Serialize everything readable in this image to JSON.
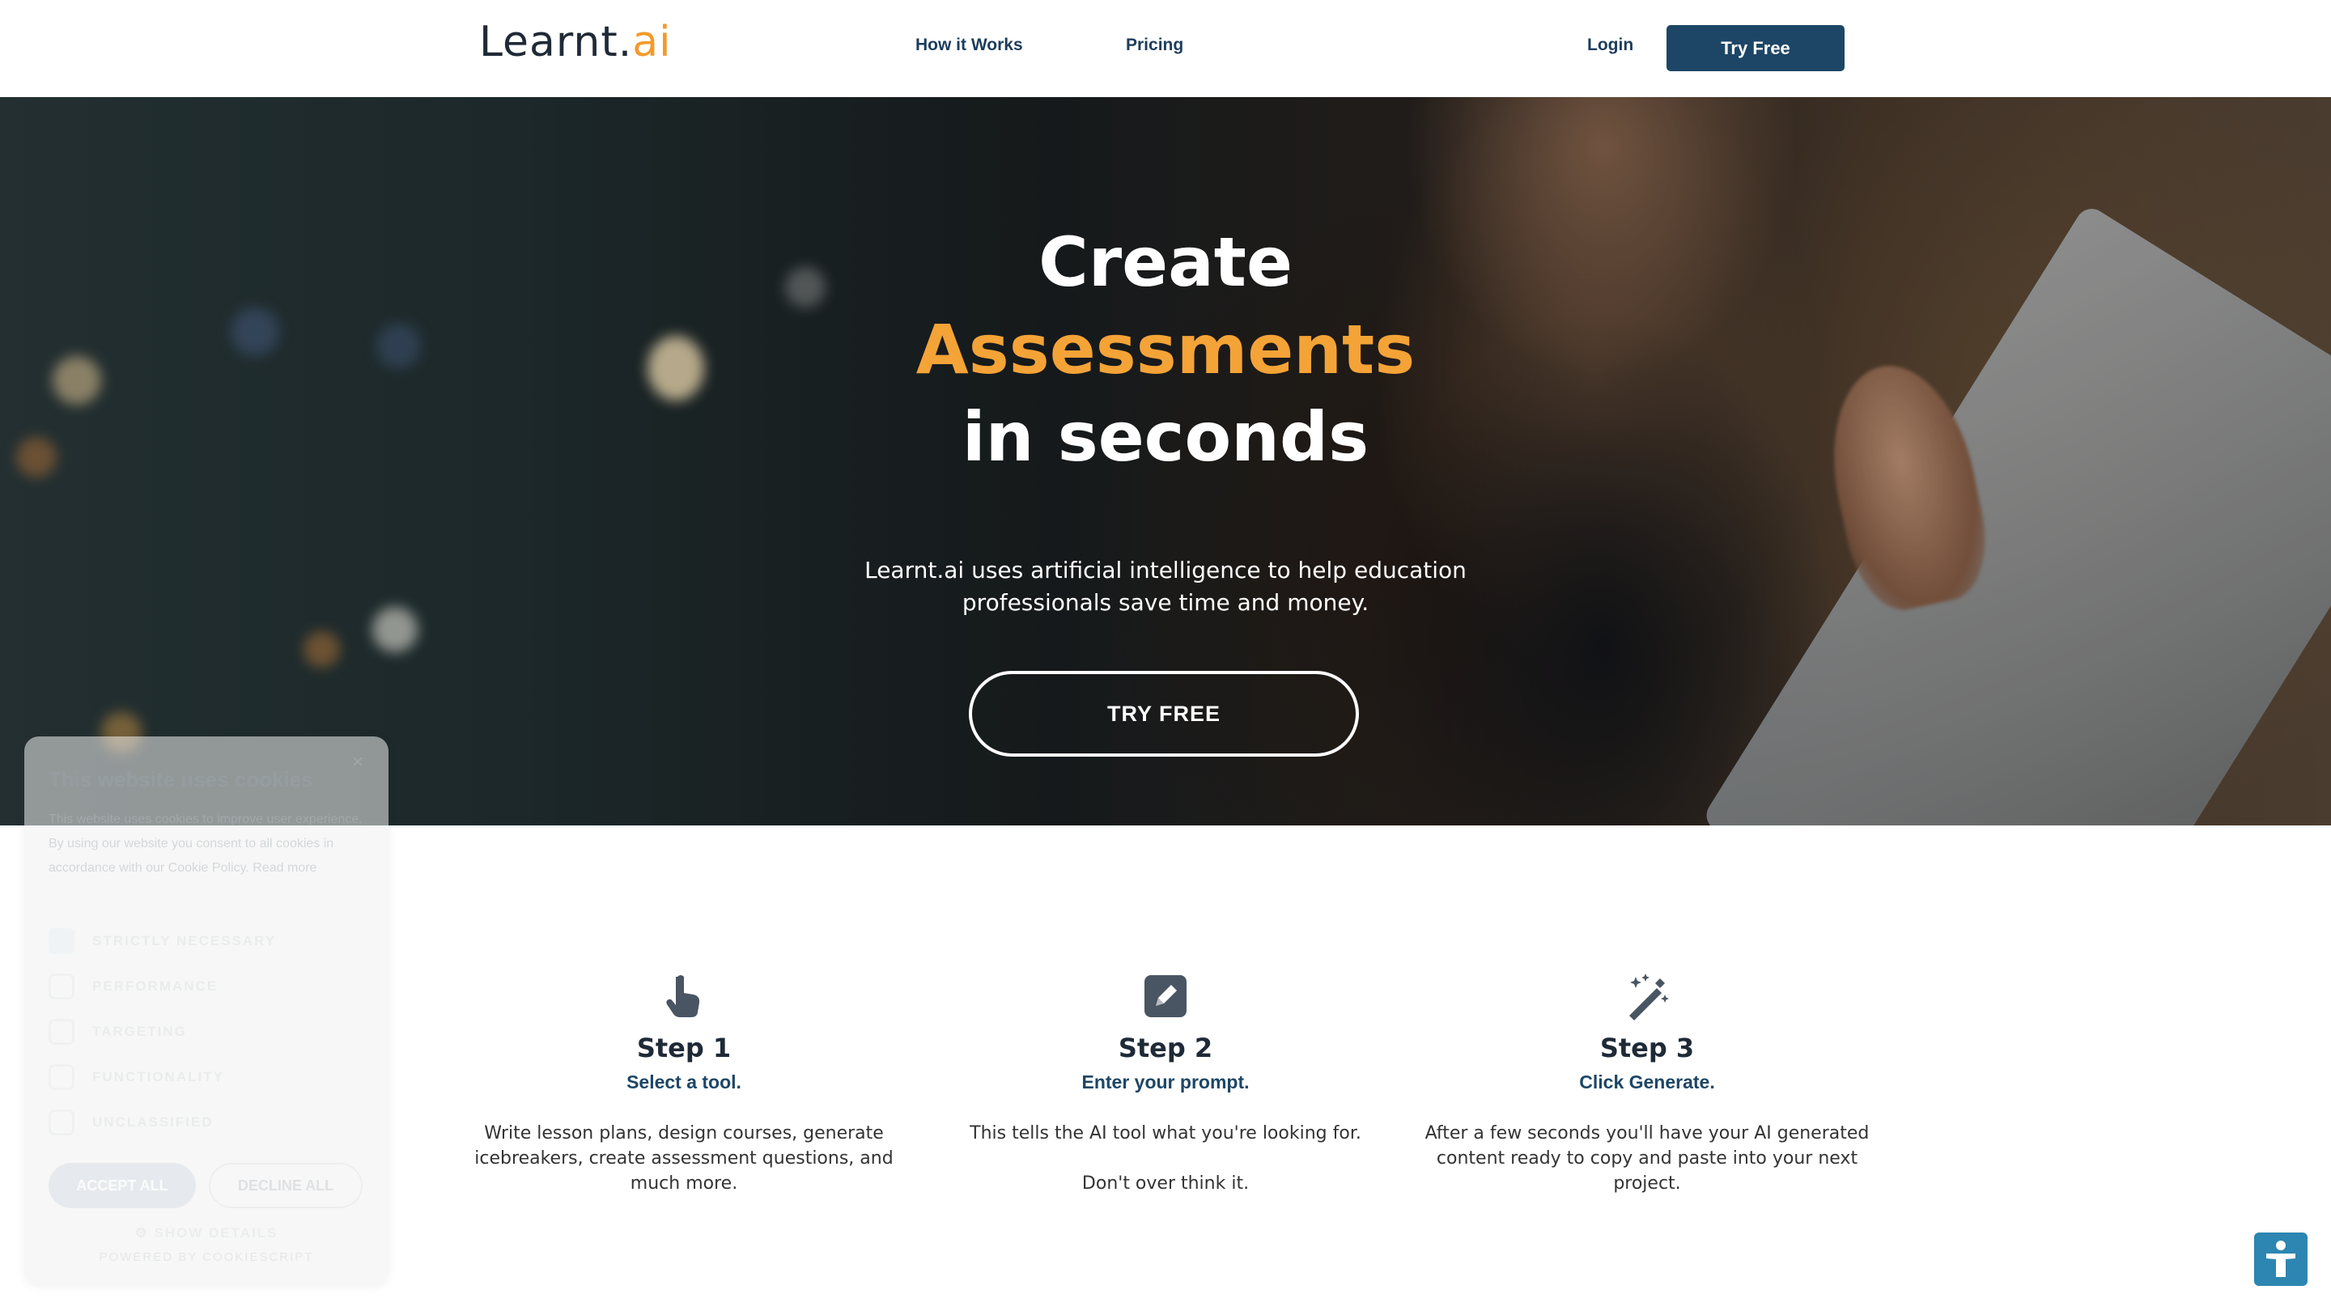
{
  "nav": {
    "logo_main": "Learnt.",
    "logo_accent": "ai",
    "links": [
      "How it Works",
      "Pricing"
    ],
    "login": "Login",
    "cta": "Try Free"
  },
  "hero": {
    "title_line1": "Create",
    "title_accent": "Assessments",
    "title_line3": "in seconds",
    "subtitle": "Learnt.ai uses artificial intelligence to help education professionals save time and money.",
    "cta": "TRY FREE",
    "accent_color": "#f4a337"
  },
  "steps": [
    {
      "icon": "pointer-hand-icon",
      "title": "Step 1",
      "subtitle": "Select a tool.",
      "description": "Write lesson plans, design courses, generate icebreakers, create assessment questions, and much more."
    },
    {
      "icon": "pencil-square-icon",
      "title": "Step 2",
      "subtitle": "Enter your prompt.",
      "description": "This tells the AI tool what you're looking for.\n\nDon't over think it."
    },
    {
      "icon": "magic-wand-icon",
      "title": "Step 3",
      "subtitle": "Click Generate.",
      "description": "After a few seconds you'll have your AI generated content ready to copy and paste into your next project."
    }
  ],
  "cookie": {
    "title": "This website uses cookies",
    "text": "This website uses cookies to improve user experience. By using our website you consent to all cookies in accordance with our Cookie Policy. Read more",
    "options": [
      "STRICTLY NECESSARY",
      "PERFORMANCE",
      "TARGETING",
      "FUNCTIONALITY",
      "UNCLASSIFIED"
    ],
    "accept": "ACCEPT ALL",
    "decline": "DECLINE ALL",
    "details": "SHOW DETAILS",
    "powered": "POWERED BY COOKIESCRIPT",
    "close": "×"
  },
  "accessibility": {
    "icon": "accessibility-person-icon"
  },
  "colors": {
    "brand_dark": "#1d4666",
    "accent": "#f39a2a",
    "text_dark": "#1f2a37"
  }
}
